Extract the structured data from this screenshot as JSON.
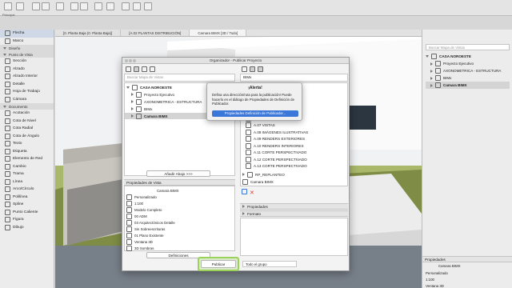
{
  "toolbar": {
    "label": "Principal"
  },
  "colors": {
    "accent": "#3b77d8",
    "highlight": "#9bd35a"
  },
  "toolbox": {
    "items": [
      {
        "label": "Flecha",
        "icon": "arrow-icon",
        "selected": true
      },
      {
        "label": "Marco",
        "icon": "marquee-icon"
      }
    ],
    "sections": [
      {
        "label": "Diseño"
      },
      {
        "label": "Punto de Vista",
        "items": [
          {
            "label": "Sección"
          },
          {
            "label": "Alzado"
          },
          {
            "label": "Alzado Interior"
          },
          {
            "label": "Detalle"
          },
          {
            "label": "Hoja de Trabajo"
          },
          {
            "label": "Cámara"
          }
        ]
      },
      {
        "label": "Documento",
        "items": [
          {
            "label": "Acotación"
          },
          {
            "label": "Cota de Nivel"
          },
          {
            "label": "Cota Radial"
          },
          {
            "label": "Cota de Ángulo"
          },
          {
            "label": "Texto"
          },
          {
            "label": "Etiqueta"
          },
          {
            "label": "Elemento de Red"
          },
          {
            "label": "Cambio"
          },
          {
            "label": "Trama"
          },
          {
            "label": "Línea"
          },
          {
            "label": "Arco/Círculo"
          },
          {
            "label": "Polilínea"
          },
          {
            "label": "Spline"
          },
          {
            "label": "Punto Caliente"
          },
          {
            "label": "Figura"
          },
          {
            "label": "Dibujo"
          }
        ]
      }
    ]
  },
  "tabs": [
    {
      "label": "[0. Planta Baja (0. Planta Baja)]"
    },
    {
      "label": "[A.02 PLANTAS DISTRIBUCIÓN]"
    },
    {
      "label": "Camara BIMX [3D / Todo]",
      "active": true
    }
  ],
  "right_panel": {
    "search_placeholder": "Buscar Mapa de Vistas",
    "tree": [
      {
        "label": "CASA NOROESTE",
        "bold": true
      },
      {
        "label": "Proyecto Ejecutivo"
      },
      {
        "label": "AXONOMETRICA - ESTRUCTURA"
      },
      {
        "label": "BIMx"
      },
      {
        "label": "Camara BIMX",
        "selected": true
      }
    ],
    "properties_title": "Propiedades",
    "prop_name": "Camara BIMX",
    "prop_rows": [
      "Personalizado",
      "1:100",
      "Ventana 3D"
    ]
  },
  "organizer": {
    "title": "Organizador - Publicar Proyecto",
    "left": {
      "search_placeholder": "Buscar Mapa de Vistas",
      "tree": [
        {
          "label": "CASA NOROESTE",
          "bold": true
        },
        {
          "label": "Proyecto Ejecutivo"
        },
        {
          "label": "AXONOMETRICA - ESTRUCTURA"
        },
        {
          "label": "BIMx"
        },
        {
          "label": "Camara BIMX",
          "selected": true
        }
      ],
      "add_button": "Añadir Abajo >>>",
      "props_title": "Propiedades de Vista",
      "prop_name": "Camara BIMX",
      "prop_rows": [
        "Personalizado",
        "1:100",
        "Modelo Completo",
        "00 ADM",
        "03 Arquitectónicos Detalle",
        "Sin Sobreescrituras",
        "01 Plano Existente",
        "Ventana 3D",
        "3D Sombras"
      ],
      "definitions_button": "Definiciones"
    },
    "right": {
      "selector": "BIMx",
      "items": [
        "A.06 CORTES",
        "A.07 VISTAS",
        "A.08 IMÁGENES ILUSTRATIVAS",
        "A.09 RENDERS EXTERIORES",
        "A.10 RENDERS INTERIORES",
        "A.11 CORTE PERSPECTIVADO",
        "A.12 CORTE PERSPECTIVADO",
        "A.13 CORTE PERSPECTIVADO"
      ],
      "folder": "RP_REPLANTEO",
      "bottom_item": "Camara BIMX",
      "sections": [
        "Propiedades",
        "Formato"
      ]
    },
    "publish_button": "Publicar",
    "scope_select": "Todo el grupo"
  },
  "alert": {
    "title": "¡Alerta!",
    "message": "Defina una dirección/ruta para la publicación! Puede hacerlo en el diálogo de Propiedades de Definición de Publicador.",
    "button": "Propiedades Definición de Publicador..."
  }
}
